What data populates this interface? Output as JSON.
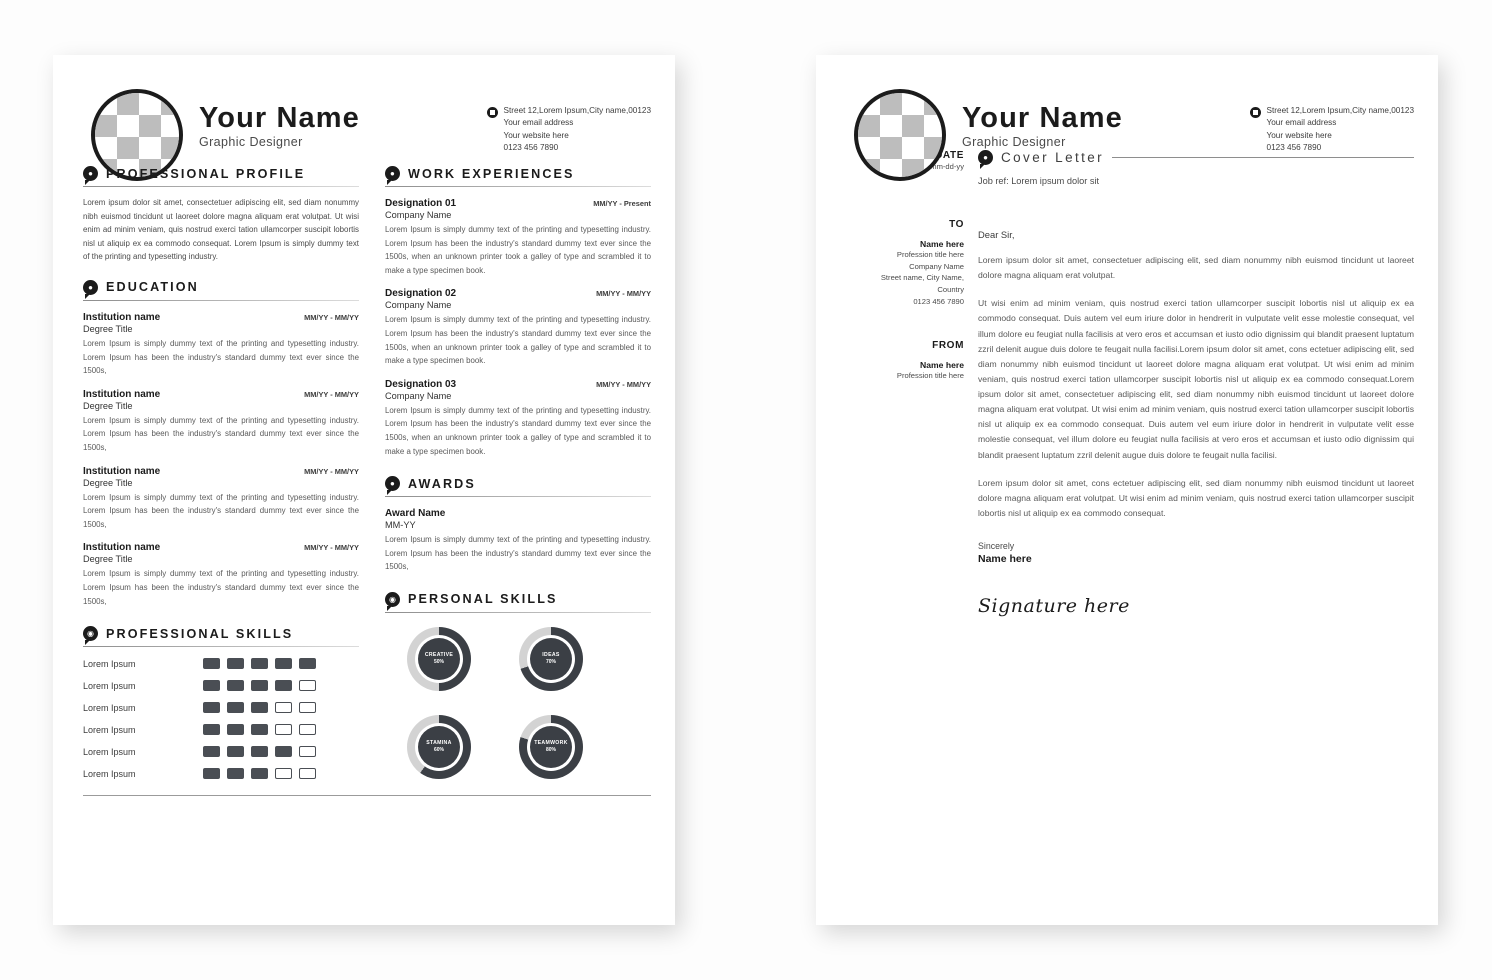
{
  "document": {
    "type": "resume-cv-template",
    "pages": 2
  },
  "colors": {
    "ink": "#1b1b1b",
    "body_text": "#5a5a5a",
    "skill_fill": "#4a4e54",
    "donut_hub": "#3b3f45",
    "donut_track": "#d3d3d3",
    "page_background": "#ffffff"
  },
  "header": {
    "name": "Your Name",
    "role": "Graphic Designer",
    "avatar_icon": "checkerboard-placeholder",
    "contact_icon": "location-pin-icon",
    "contact": [
      "Street 12,Lorem Ipsum,City name,00123",
      "Your email address",
      "Your website here",
      "0123 456 7890"
    ]
  },
  "page_one": {
    "left_column": {
      "professional_profile": {
        "title": "PROFESSIONAL PROFILE",
        "icon": "user-badge-icon",
        "text": "Lorem ipsum dolor sit amet, consectetuer adipiscing elit, sed diam nonummy nibh euismod tincidunt ut laoreet dolore magna aliquam erat volutpat. Ut wisi enim ad minim veniam, quis nostrud exerci tation ullamcorper suscipit lobortis nisl ut aliquip ex ea commodo consequat. Lorem Ipsum is simply dummy text of the printing and typesetting industry."
      },
      "education": {
        "title": "EDUCATION",
        "icon": "graduation-cap-icon",
        "entries": [
          {
            "institution": "Institution name",
            "date": "MM/YY - MM/YY",
            "degree": "Degree Title",
            "description": "Lorem Ipsum is simply dummy text of the printing and typesetting industry. Lorem Ipsum has been the industry's standard dummy text ever since the 1500s,"
          },
          {
            "institution": "Institution name",
            "date": "MM/YY - MM/YY",
            "degree": "Degree Title",
            "description": "Lorem Ipsum is simply dummy text of the printing and typesetting industry. Lorem Ipsum has been the industry's standard dummy text ever since the 1500s,"
          },
          {
            "institution": "Institution name",
            "date": "MM/YY - MM/YY",
            "degree": "Degree Title",
            "description": "Lorem Ipsum is simply dummy text of the printing and typesetting industry. Lorem Ipsum has been the industry's standard dummy text ever since the 1500s,"
          },
          {
            "institution": "Institution name",
            "date": "MM/YY - MM/YY",
            "degree": "Degree Title",
            "description": "Lorem Ipsum is simply dummy text of the printing and typesetting industry. Lorem Ipsum has been the industry's standard dummy text ever since the 1500s,"
          }
        ]
      },
      "professional_skills": {
        "title": "PROFESSIONAL SKILLS",
        "icon": "gear-icon",
        "max_level": 5,
        "items": [
          {
            "label": "Lorem Ipsum",
            "level": 5
          },
          {
            "label": "Lorem Ipsum",
            "level": 4
          },
          {
            "label": "Lorem Ipsum",
            "level": 3
          },
          {
            "label": "Lorem Ipsum",
            "level": 3
          },
          {
            "label": "Lorem Ipsum",
            "level": 4
          },
          {
            "label": "Lorem Ipsum",
            "level": 3
          }
        ]
      }
    },
    "right_column": {
      "work_experiences": {
        "title": "WORK EXPERIENCES",
        "icon": "briefcase-badge-icon",
        "entries": [
          {
            "designation": "Designation 01",
            "date": "MM/YY - Present",
            "company": "Company Name",
            "description": "Lorem Ipsum is simply dummy text of the printing and typesetting industry. Lorem Ipsum has been the industry's standard dummy text ever since the 1500s, when an unknown printer took a galley of type and scrambled it to make a type specimen book."
          },
          {
            "designation": "Designation 02",
            "date": "MM/YY - MM/YY",
            "company": "Company Name",
            "description": "Lorem Ipsum is simply dummy text of the printing and typesetting industry. Lorem Ipsum has been the industry's standard dummy text ever since the 1500s, when an unknown printer took a galley of type and scrambled it to make a type specimen book."
          },
          {
            "designation": "Designation 03",
            "date": "MM/YY - MM/YY",
            "company": "Company Name",
            "description": "Lorem Ipsum is simply dummy text of the printing and typesetting industry. Lorem Ipsum has been the industry's standard dummy text ever since the 1500s, when an unknown printer took a galley of type and scrambled it to make a type specimen book."
          }
        ]
      },
      "awards": {
        "title": "AWARDS",
        "icon": "trophy-badge-icon",
        "entries": [
          {
            "award": "Award Name",
            "date": "MM-YY",
            "description": "Lorem Ipsum is simply dummy text of the printing and typesetting industry. Lorem Ipsum has been the industry's standard dummy text ever since the 1500s,"
          }
        ]
      },
      "personal_skills": {
        "title": "PERSONAL SKILLS",
        "icon": "target-badge-icon",
        "donuts": [
          {
            "label": "CREATIVE",
            "value": 50,
            "value_label": "50%"
          },
          {
            "label": "IDEAS",
            "value": 70,
            "value_label": "70%"
          },
          {
            "label": "STAMINA",
            "value": 60,
            "value_label": "60%"
          },
          {
            "label": "TEAMWORK",
            "value": 80,
            "value_label": "80%"
          }
        ]
      }
    }
  },
  "page_two": {
    "date": {
      "key": "DATE",
      "value": "mm-dd-yy"
    },
    "cover_letter": {
      "title": "Cover Letter",
      "icon": "document-badge-icon",
      "job_ref": "Job ref: Lorem ipsum dolor sit",
      "salutation": "Dear Sir,"
    },
    "to": {
      "key": "TO",
      "lines": [
        "Name here",
        "Profession title here",
        "Company Name",
        "Street name, City Name,",
        "Country",
        "0123 456 7890"
      ]
    },
    "from": {
      "key": "FROM",
      "lines": [
        "Name here",
        "Profession title here"
      ]
    },
    "body_paragraphs": [
      "Lorem ipsum dolor sit amet, consectetuer adipiscing elit, sed diam nonummy nibh euismod tincidunt ut laoreet dolore magna aliquam erat volutpat.",
      "Ut wisi enim ad minim veniam, quis nostrud exerci tation ullamcorper suscipit lobortis nisl ut aliquip ex ea commodo consequat. Duis autem vel eum iriure dolor in hendrerit in vulputate velit esse molestie consequat, vel illum dolore eu feugiat nulla facilisis at vero eros et accumsan et iusto odio dignissim qui blandit praesent luptatum zzril delenit augue duis dolore te feugait nulla facilisi.Lorem ipsum dolor sit amet, cons ectetuer adipiscing elit, sed diam nonummy nibh euismod tincidunt ut laoreet dolore magna aliquam erat volutpat. Ut wisi enim ad minim veniam, quis nostrud exerci tation ullamcorper suscipit lobortis nisl ut aliquip ex ea commodo consequat.Lorem ipsum dolor sit amet, consectetuer adipiscing elit, sed diam nonummy nibh euismod tincidunt ut laoreet dolore magna aliquam erat volutpat. Ut wisi enim ad minim veniam, quis nostrud exerci tation ullamcorper suscipit lobortis nisl ut aliquip ex ea commodo consequat. Duis autem vel eum iriure dolor in hendrerit in vulputate velit esse molestie consequat, vel illum dolore eu feugiat nulla facilisis at vero eros et accumsan et iusto odio dignissim qui blandit praesent luptatum zzril delenit augue duis dolore te feugait nulla facilisi.",
      "Lorem ipsum dolor sit amet, cons ectetuer adipiscing elit, sed diam nonummy nibh euismod tincidunt ut laoreet dolore magna aliquam erat volutpat. Ut wisi enim ad minim veniam, quis nostrud exerci tation ullamcorper suscipit lobortis nisl ut aliquip ex ea commodo consequat."
    ],
    "closing": {
      "sincerely": "Sincerely",
      "name": "Name here",
      "signature": "Signature here"
    }
  }
}
